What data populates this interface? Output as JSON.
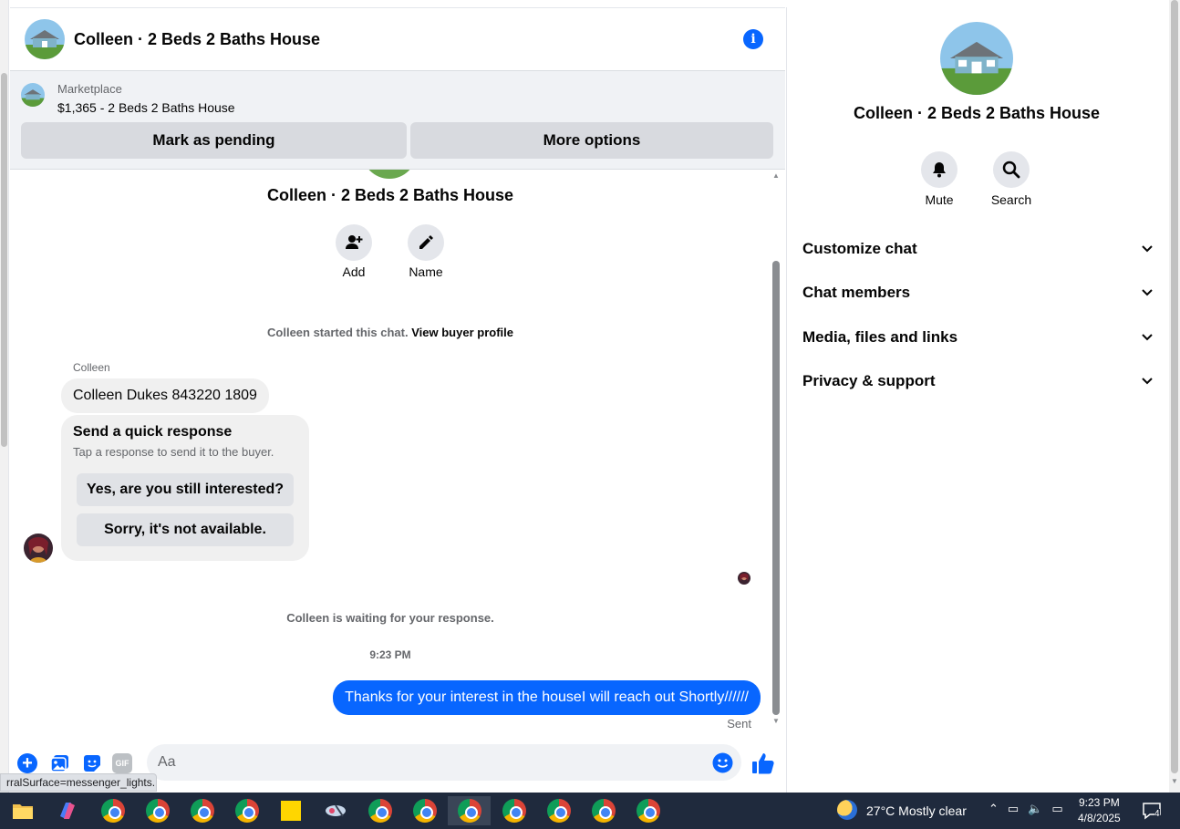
{
  "chat": {
    "title": "Colleen · 2 Beds 2 Baths House"
  },
  "marketplace": {
    "label": "Marketplace",
    "listing": "$1,365 - 2 Beds 2 Baths House",
    "mark_pending": "Mark as pending",
    "more_options": "More options"
  },
  "conversation": {
    "title": "Colleen · 2 Beds 2 Baths House",
    "actions": {
      "add": "Add",
      "name": "Name"
    },
    "started_text": "Colleen started this chat.",
    "view_profile": "View buyer profile",
    "sender": "Colleen",
    "message_1": "Colleen Dukes 843220 1809",
    "quick_response": {
      "title": "Send a quick response",
      "subtitle": "Tap a response to send it to the buyer.",
      "options": [
        "Yes, are you still interested?",
        "Sorry, it's not available."
      ]
    },
    "waiting": "Colleen is waiting for your response.",
    "time": "9:23 PM",
    "sent_message": "Thanks for your interest in the houseI will reach out Shortly//////",
    "sent_status": "Sent"
  },
  "composer": {
    "placeholder": "Aa",
    "gif_label": "GIF"
  },
  "status_url": "rralSurface=messenger_lights...",
  "right_panel": {
    "title": "Colleen · 2 Beds 2 Baths House",
    "mute": "Mute",
    "search": "Search",
    "sections": [
      "Customize chat",
      "Chat members",
      "Media, files and links",
      "Privacy & support"
    ]
  },
  "taskbar": {
    "weather": "27°C  Mostly clear",
    "time": "9:23 PM",
    "date": "4/8/2025",
    "notifications": "4"
  },
  "colors": {
    "accent": "#0866ff",
    "bubble_incoming": "#f0f0f0",
    "taskbar": "#1f2a3d"
  }
}
